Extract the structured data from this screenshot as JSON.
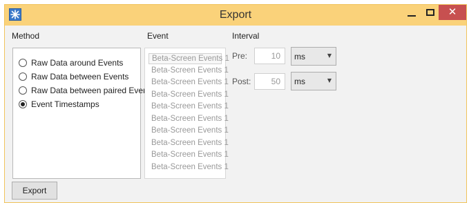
{
  "window": {
    "title": "Export",
    "close_glyph": "✕"
  },
  "icons": {
    "app": "app-icon",
    "minimize": "minimize-icon",
    "maximize": "maximize-icon",
    "close": "close-icon"
  },
  "colors": {
    "titlebar": "#fad27a",
    "close_button": "#c75050",
    "border": "#f0c35a"
  },
  "method": {
    "label": "Method",
    "options": [
      {
        "label": "Raw Data around Events",
        "selected": false
      },
      {
        "label": "Raw Data between Events",
        "selected": false
      },
      {
        "label": "Raw Data between paired Events",
        "selected": false
      },
      {
        "label": "Event Timestamps",
        "selected": true
      }
    ]
  },
  "event": {
    "label": "Event",
    "items": [
      "Beta-Screen Events 1",
      "Beta-Screen Events 1",
      "Beta-Screen Events 1",
      "Beta-Screen Events 1",
      "Beta-Screen Events 1",
      "Beta-Screen Events 1",
      "Beta-Screen Events 1",
      "Beta-Screen Events 1",
      "Beta-Screen Events 1",
      "Beta-Screen Events 1"
    ]
  },
  "interval": {
    "label": "Interval",
    "pre": {
      "label": "Pre:",
      "value": "10",
      "unit": "ms"
    },
    "post": {
      "label": "Post:",
      "value": "50",
      "unit": "ms"
    },
    "dropdown_glyph": "▼"
  },
  "export_button": "Export"
}
